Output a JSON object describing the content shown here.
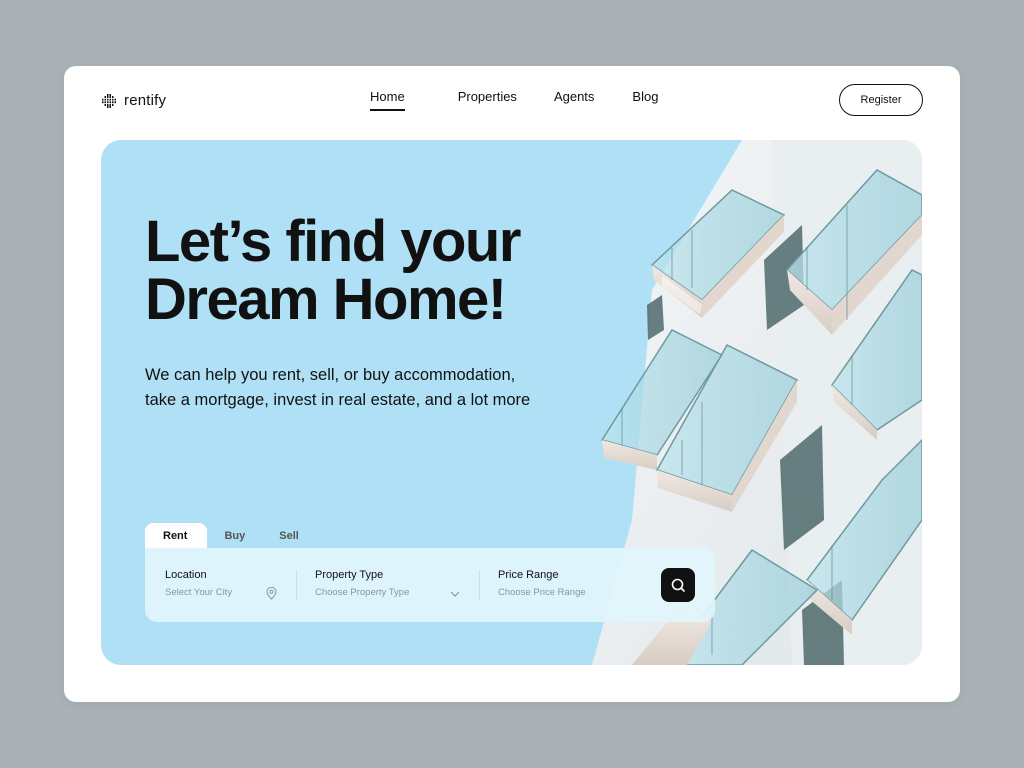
{
  "brand": {
    "name": "rentify"
  },
  "nav": {
    "items": [
      "Home",
      "Properties",
      "Agents",
      "Blog"
    ],
    "active": "Home"
  },
  "header": {
    "register_label": "Register"
  },
  "hero": {
    "headline_line1": "Let’s find your",
    "headline_line2": "Dream Home!",
    "subtitle_line1": "We can help you rent, sell, or buy accommodation,",
    "subtitle_line2": "take a mortgage, invest in real estate, and a lot more",
    "bg_color": "#afe0f5"
  },
  "search": {
    "tabs": [
      "Rent",
      "Buy",
      "Sell"
    ],
    "active_tab": "Rent",
    "fields": [
      {
        "label": "Location",
        "placeholder": "Select Your City",
        "icon": "location-pin-icon"
      },
      {
        "label": "Property Type",
        "placeholder": "Choose Property Type",
        "icon": "chevron-down-icon"
      },
      {
        "label": "Price Range",
        "placeholder": "Choose Price Range"
      }
    ],
    "button_icon": "search-icon"
  }
}
